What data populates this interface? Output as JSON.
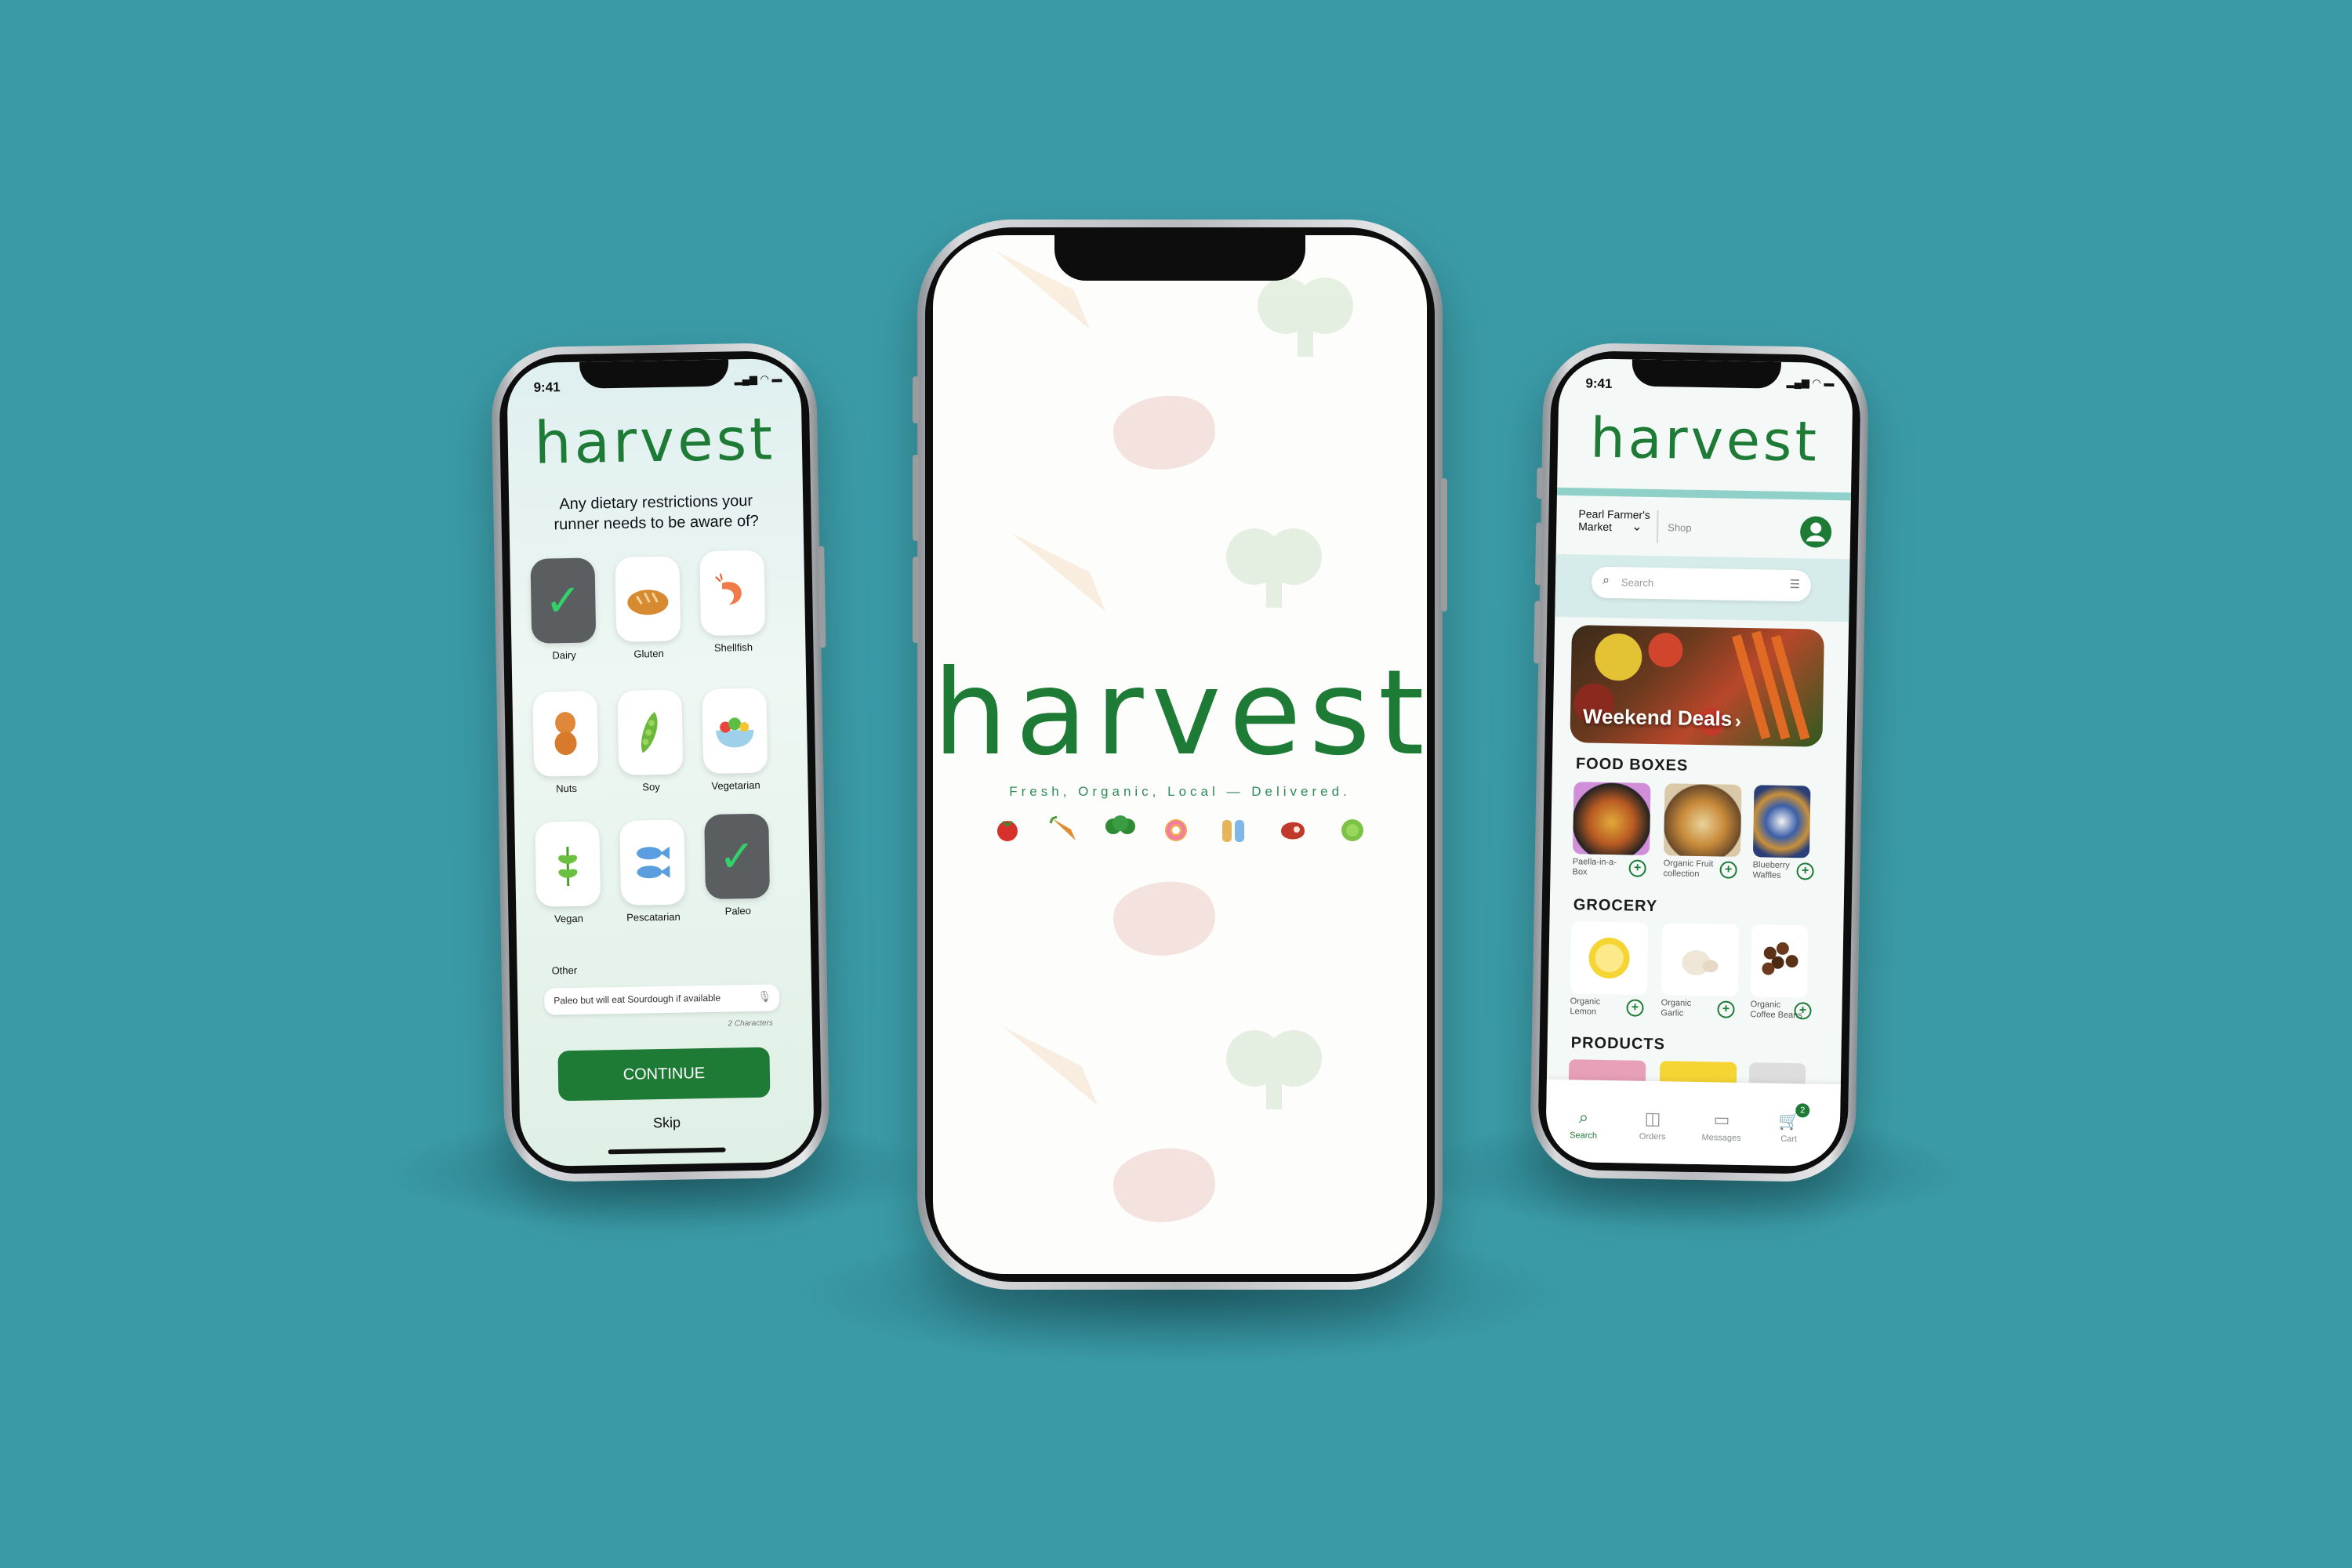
{
  "left_screen": {
    "status_time": "9:41",
    "logo": "harvest",
    "question": "Any dietary restrictions your runner needs to be aware of?",
    "options": [
      {
        "label": "Dairy",
        "icon": "check-icon",
        "selected": true
      },
      {
        "label": "Gluten",
        "icon": "bread-icon",
        "selected": false
      },
      {
        "label": "Shellfish",
        "icon": "shrimp-icon",
        "selected": false
      },
      {
        "label": "Nuts",
        "icon": "peanut-icon",
        "selected": false
      },
      {
        "label": "Soy",
        "icon": "soybean-icon",
        "selected": false
      },
      {
        "label": "Vegetarian",
        "icon": "salad-icon",
        "selected": false
      },
      {
        "label": "Vegan",
        "icon": "leaf-icon",
        "selected": false
      },
      {
        "label": "Pescatarian",
        "icon": "fish-icon",
        "selected": false
      },
      {
        "label": "Paleo",
        "icon": "check-icon",
        "selected": true
      }
    ],
    "other_label": "Other",
    "other_value": "Paleo but will eat Sourdough if available",
    "char_count": "2 Characters",
    "continue_label": "CONTINUE",
    "skip_label": "Skip"
  },
  "center_screen": {
    "logo": "harvest",
    "tagline": "Fresh, Organic, Local — Delivered."
  },
  "right_screen": {
    "status_time": "9:41",
    "logo": "harvest",
    "market": "Pearl Farmer's Market",
    "shop_label": "Shop",
    "search_placeholder": "Search",
    "banner": "Weekend Deals",
    "food_boxes_title": "FOOD BOXES",
    "food_boxes": [
      "Paella-in-a-Box",
      "Organic Fruit collection",
      "Blueberry Waffles"
    ],
    "grocery_title": "GROCERY",
    "grocery": [
      "Organic Lemon",
      "Organic Garlic",
      "Organic Coffee Beans"
    ],
    "products_title": "PRODUCTS",
    "tabs": [
      "Search",
      "Orders",
      "Messages",
      "Cart"
    ],
    "cart_badge": "2",
    "colors": {
      "brand": "#1e7b35",
      "background": "#3a9ba7"
    }
  }
}
